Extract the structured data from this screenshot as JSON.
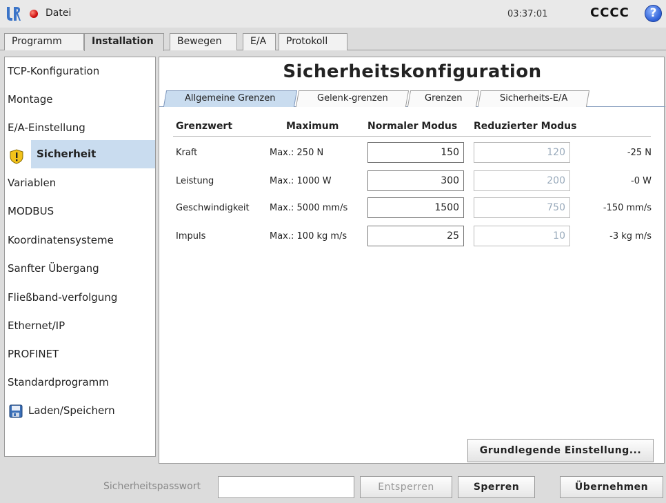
{
  "topbar": {
    "file_menu": "Datei",
    "clock": "03:37:01",
    "robot_name": "CCCC",
    "help": "?"
  },
  "main_tabs": [
    "Programm",
    "Installation",
    "Bewegen",
    "E/A",
    "Protokoll"
  ],
  "sidebar": {
    "items": [
      "TCP-Konfiguration",
      "Montage",
      "E/A-Einstellung",
      "Sicherheit",
      "Variablen",
      "MODBUS",
      "Koordinatensysteme",
      "Sanfter Übergang",
      "Fließband-verfolgung",
      "Ethernet/IP",
      "PROFINET",
      "Standardprogramm",
      "Laden/Speichern"
    ]
  },
  "content": {
    "title": "Sicherheitskonfiguration",
    "subtabs": [
      "Allgemeine Grenzen",
      "Gelenk-grenzen",
      "Grenzen",
      "Sicherheits-E/A"
    ],
    "headers": [
      "Grenzwert",
      "Maximum",
      "Normaler Modus",
      "Reduzierter Modus"
    ],
    "rows": [
      {
        "label": "Kraft",
        "max": "Max.: 250 N",
        "normal": "150",
        "reduced": "120",
        "delta": "-25 N"
      },
      {
        "label": "Leistung",
        "max": "Max.: 1000 W",
        "normal": "300",
        "reduced": "200",
        "delta": "-0 W"
      },
      {
        "label": "Geschwindigkeit",
        "max": "Max.: 5000 mm/s",
        "normal": "1500",
        "reduced": "750",
        "delta": "-150 mm/s"
      },
      {
        "label": "Impuls",
        "max": "Max.: 100 kg m/s",
        "normal": "25",
        "reduced": "10",
        "delta": "-3 kg m/s"
      }
    ],
    "basic_settings_button": "Grundlegende Einstellung..."
  },
  "bottom": {
    "password_label": "Sicherheitspasswort",
    "password_value": "",
    "unlock": "Entsperren",
    "lock": "Sperren",
    "apply": "Übernehmen"
  },
  "colors": {
    "active_tab": "#c9dcef",
    "status_dot": "#d01010",
    "help": "#2d5fd6"
  }
}
